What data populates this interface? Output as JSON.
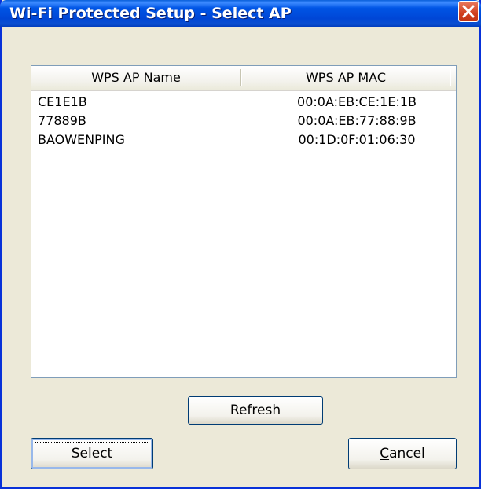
{
  "window": {
    "title": "Wi-Fi Protected Setup - Select AP"
  },
  "list": {
    "columns": [
      "WPS AP Name",
      "WPS AP MAC"
    ],
    "rows": [
      {
        "name": "CE1E1B",
        "mac": "00:0A:EB:CE:1E:1B"
      },
      {
        "name": "77889B",
        "mac": "00:0A:EB:77:88:9B"
      },
      {
        "name": "BAOWENPING",
        "mac": "00:1D:0F:01:06:30"
      }
    ]
  },
  "buttons": {
    "refresh": "Refresh",
    "select": "Select",
    "cancel": "Cancel"
  },
  "colors": {
    "title_bar": "#0055e5",
    "close_button": "#d0401f",
    "dialog_bg": "#ece9d8"
  }
}
